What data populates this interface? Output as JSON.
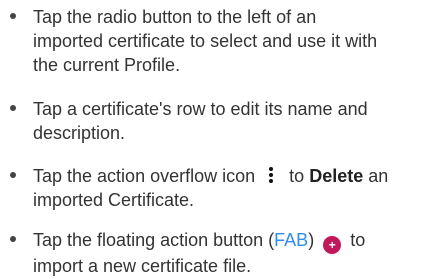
{
  "bullets": [
    {
      "lines": [
        "Tap the radio button to the left of an",
        "imported certificate to select and use it with",
        "the current Profile."
      ]
    },
    {
      "lines": [
        "Tap a certificate's row to edit its name and",
        "description."
      ]
    },
    {
      "line1_before": "Tap the action overflow icon",
      "line1_bold": "Delete",
      "line1_to": "to",
      "line1_after": "an",
      "line2": "imported Certificate.",
      "icon": "more-vert-icon"
    },
    {
      "line1_before": "Tap the floating action button (",
      "line1_link": "FAB",
      "line1_after": ")",
      "line1_to": "to",
      "fab_symbol": "+",
      "line2": "import a new certificate file.",
      "icon": "fab-add-icon",
      "fab_color": "#c2185b",
      "link_color": "#2f8ee8"
    }
  ]
}
